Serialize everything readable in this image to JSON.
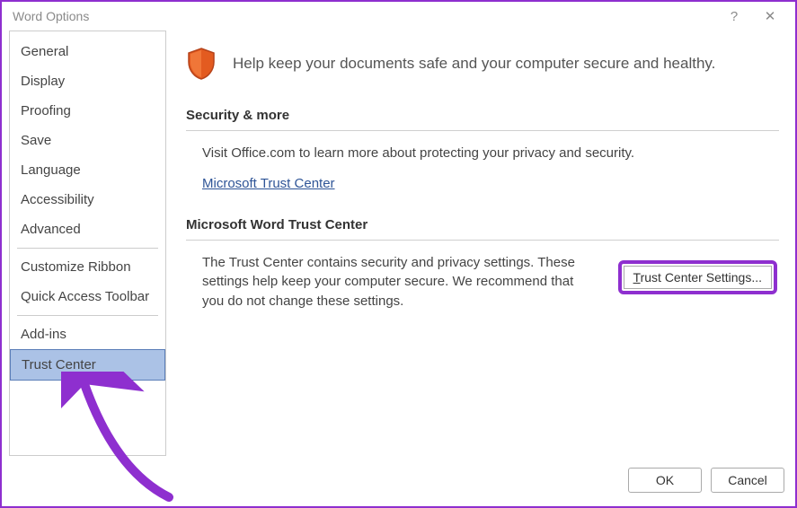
{
  "window": {
    "title": "Word Options",
    "help": "?",
    "close": "✕"
  },
  "sidebar": {
    "items": [
      {
        "label": "General"
      },
      {
        "label": "Display"
      },
      {
        "label": "Proofing"
      },
      {
        "label": "Save"
      },
      {
        "label": "Language"
      },
      {
        "label": "Accessibility"
      },
      {
        "label": "Advanced"
      }
    ],
    "group2": [
      {
        "label": "Customize Ribbon"
      },
      {
        "label": "Quick Access Toolbar"
      }
    ],
    "group3": [
      {
        "label": "Add-ins"
      },
      {
        "label": "Trust Center",
        "selected": true
      }
    ]
  },
  "content": {
    "intro": "Help keep your documents safe and your computer secure and healthy.",
    "sec1_heading": "Security & more",
    "sec1_body": "Visit Office.com to learn more about protecting your privacy and security.",
    "sec1_link": "Microsoft Trust Center",
    "sec2_heading": "Microsoft Word Trust Center",
    "sec2_body": "The Trust Center contains security and privacy settings. These settings help keep your computer secure. We recommend that you do not change these settings.",
    "tc_button_prefix": "T",
    "tc_button_rest": "rust Center Settings..."
  },
  "footer": {
    "ok": "OK",
    "cancel": "Cancel"
  }
}
